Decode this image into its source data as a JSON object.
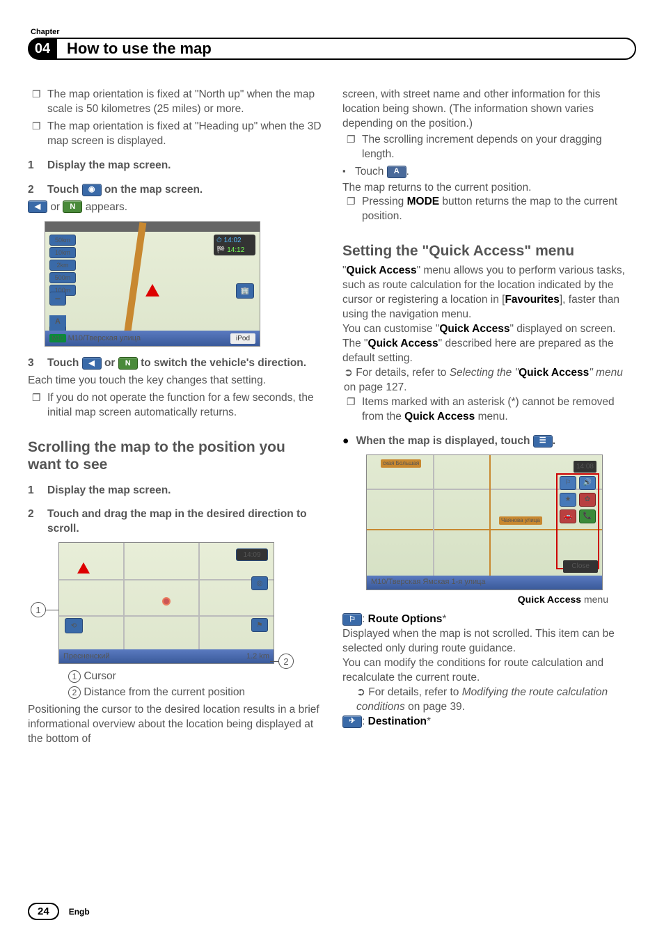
{
  "header": {
    "chapter_label": "Chapter",
    "chapter_number": "04",
    "title": "How to use the map"
  },
  "col1": {
    "b1": "The map orientation is fixed at \"North up\" when the map scale is 50 kilometres (25 miles) or more.",
    "b2": "The map orientation is fixed at \"Heading up\" when the 3D map screen is displayed.",
    "s1_n": "1",
    "s1_t": "Display the map screen.",
    "s2_n": "2",
    "s2_t1": "Touch ",
    "s2_t2": " on the map screen.",
    "s2_sub1": " or ",
    "s2_sub2": " appears.",
    "map1": {
      "scales": [
        "50km",
        "10km",
        "2km",
        "500m",
        "100m"
      ],
      "time1": "14:02",
      "time2": "14:12",
      "m10": "M10",
      "street": "М10/Тверская улица",
      "ipod": "iPod"
    },
    "s3_n": "3",
    "s3_t1": "Touch ",
    "s3_t2": " or ",
    "s3_t3": " to switch the vehicle's direction.",
    "s3_p": "Each time you touch the key changes that setting.",
    "s3_b": "If you do not operate the function for a few seconds, the initial map screen automatically returns.",
    "h2": "Scrolling the map to the position you want to see",
    "s4_n": "1",
    "s4_t": "Display the map screen.",
    "s5_n": "2",
    "s5_t": "Touch and drag the map in the desired direction to scroll.",
    "map2": {
      "time": "14:09",
      "street": "Пресненский",
      "dist": "1.2 km"
    },
    "cap1_n": "①",
    "cap1_t": "Cursor",
    "cap2_n": "②",
    "cap2_t": "Distance from the current position",
    "p_end": "Positioning the cursor to the desired location results in a brief informational overview about the location being displayed at the bottom of"
  },
  "col2": {
    "p1": "screen, with street name and other information for this location being shown. (The information shown varies depending on the position.)",
    "b1": "The scrolling increment depends on your dragging length.",
    "touch_t1": "Touch ",
    "p2": "The map returns to the current position.",
    "b2a": "Pressing ",
    "b2b": "MODE",
    "b2c": " button returns the map to the current position.",
    "h1a": "Setting the ",
    "h1b": "\"Quick Access\"",
    "h1c": " menu",
    "p3a": "\"",
    "p3b": "Quick Access",
    "p3c": "\" menu allows you to perform various tasks, such as route calculation for the location indicated by the cursor or registering a location in [",
    "p3d": "Favourites",
    "p3e": "], faster than using the navigation menu.",
    "p4a": "You can customise \"",
    "p4b": "Quick Access",
    "p4c": "\" displayed on screen. The \"",
    "p4d": "Quick Access",
    "p4e": "\" described here are prepared as the default setting.",
    "r1a": "For details, refer to ",
    "r1b": "Selecting the \"",
    "r1c": "Quick Access",
    "r1d": "\" menu",
    "r1e": " on page 127.",
    "b3a": "Items marked with an asterisk (*) cannot be removed from the ",
    "b3b": "Quick Access",
    "b3c": " menu.",
    "dot1a": "When the map is displayed, touch ",
    "dot1b": ".",
    "map3": {
      "time": "14:08",
      "close": "Close",
      "street": "М10/Тверская Ямская 1-я улица",
      "lab1": "Чаянова улица",
      "lab2": "ская Большая"
    },
    "qa_cap_a": "Quick Access",
    "qa_cap_b": " menu",
    "ro_t": ": ",
    "ro_b": "Route Options",
    "ro_s": "*",
    "ro_p": "Displayed when the map is not scrolled. This item can be selected only during route guidance.",
    "ro_p2": "You can modify the conditions for route calculation and recalculate the current route.",
    "r2a": "For details, refer to ",
    "r2b": "Modifying the route calculation conditions",
    "r2c": " on page 39.",
    "de_t": ": ",
    "de_b": "Destination",
    "de_s": "*"
  },
  "footer": {
    "page": "24",
    "lang": "Engb"
  },
  "icons": {
    "compass": "◉",
    "arrow_left": "◀",
    "north": "N",
    "a": "A",
    "menu": "☰",
    "route": "⚐",
    "dest": "✈"
  }
}
